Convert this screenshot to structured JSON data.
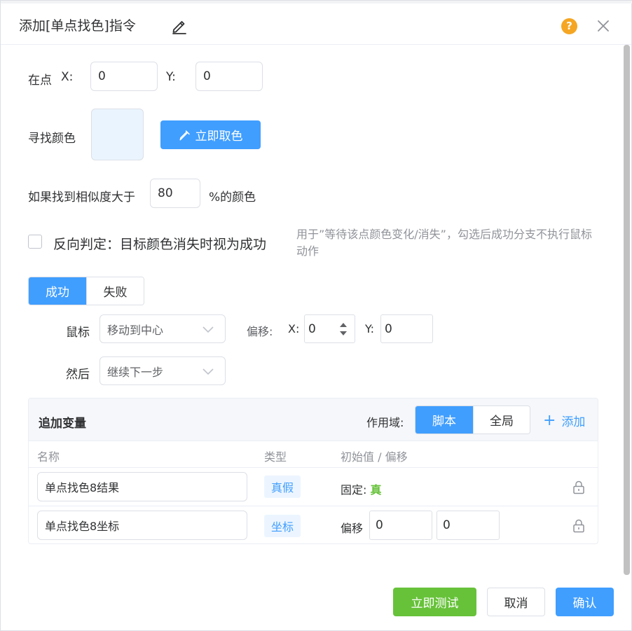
{
  "dialog": {
    "title": "添加[单点找色]指令",
    "help": "?"
  },
  "point": {
    "label": "在点",
    "x_label": "X:",
    "x_value": "0",
    "y_label": "Y:",
    "y_value": "0"
  },
  "color": {
    "label": "寻找颜色",
    "swatch_color": "#eaf4fe",
    "pick_button": "立即取色"
  },
  "similarity": {
    "label": "如果找到相似度大于",
    "value": "80",
    "suffix": "%的颜色"
  },
  "reverse": {
    "checked": false,
    "label": "反向判定：目标颜色消失时视为成功",
    "hint": "用于”等待该点颜色变化/消失”，勾选后成功分支不执行鼠标动作"
  },
  "branch_tabs": {
    "success": "成功",
    "fail": "失败",
    "active": "success"
  },
  "mouse": {
    "label": "鼠标",
    "action": "移动到中心",
    "offset_label": "偏移:",
    "x_label": "X:",
    "x_value": "0",
    "y_label": "Y:",
    "y_value": "0"
  },
  "then": {
    "label": "然后",
    "action": "继续下一步"
  },
  "variables": {
    "title": "追加变量",
    "scope_label": "作用域:",
    "scope_script": "脚本",
    "scope_global": "全局",
    "scope_active": "script",
    "add": "添加",
    "columns": {
      "name": "名称",
      "type": "类型",
      "initial": "初始值 / 偏移"
    },
    "rows": [
      {
        "name": "单点找色8结果",
        "type": "真假",
        "init_prefix": "固定:",
        "init_value": "真"
      },
      {
        "name": "单点找色8坐标",
        "type": "坐标",
        "init_prefix": "偏移",
        "offset_x": "0",
        "offset_y": "0"
      }
    ]
  },
  "footer": {
    "test": "立即测试",
    "cancel": "取消",
    "confirm": "确认"
  },
  "colors": {
    "primary": "#409eff",
    "success": "#67c23a",
    "warning": "#f5a623"
  }
}
